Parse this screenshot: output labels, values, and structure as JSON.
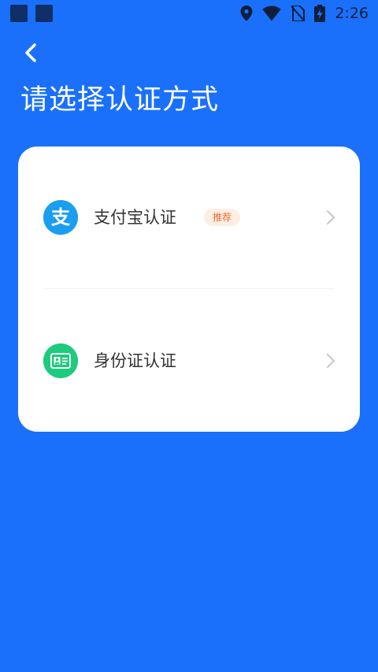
{
  "status_bar": {
    "time": "2:26",
    "icons": [
      "notification-square-icon",
      "notification-square-icon",
      "location-icon",
      "wifi-icon",
      "no-sim-icon",
      "battery-charging-icon"
    ]
  },
  "header": {
    "back_icon": "chevron-left-icon",
    "title": "请选择认证方式"
  },
  "options": [
    {
      "label": "支付宝认证",
      "badge": "推荐",
      "icon": "alipay-icon",
      "icon_glyph": "支",
      "icon_color": "#1a9ef0"
    },
    {
      "label": "身份证认证",
      "icon": "id-card-icon",
      "icon_color": "#1ccb7d"
    }
  ],
  "colors": {
    "background": "#1a70fb",
    "card": "#ffffff",
    "badge_bg": "#fdeee3",
    "badge_text": "#ee6b2b"
  }
}
